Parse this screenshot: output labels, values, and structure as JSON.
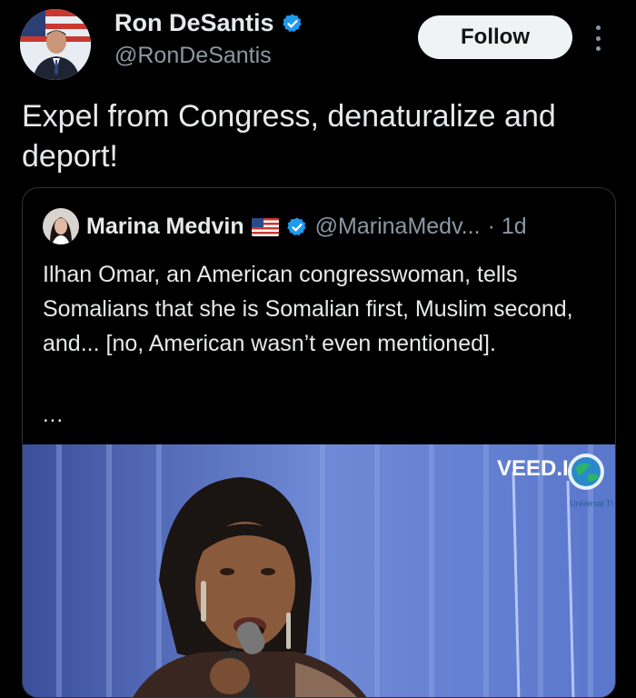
{
  "tweet": {
    "author_name": "Ron DeSantis",
    "author_handle": "@RonDeSantis",
    "follow_label": "Follow",
    "text": "Expel from Congress, denaturalize and deport!"
  },
  "quoted_tweet": {
    "author_name": "Marina Medvin",
    "author_handle": "@MarinaMedv...",
    "time": "· 1d",
    "text": "Ilhan Omar, an American congresswoman, tells Somalians that she is Somalian first, Muslim second, and... [no, American wasn’t even mentioned].",
    "truncation": "...",
    "media_watermark": "VEED.IO",
    "media_watermark_sub": "Universal TV"
  },
  "icons": {
    "verified": "verified-badge-icon",
    "more": "more-options-icon",
    "flag": "us-flag-icon"
  },
  "colors": {
    "background": "#000000",
    "text": "#e7e9ea",
    "secondary_text": "#8b98a5",
    "verified_blue": "#1d9bf0",
    "follow_bg": "#eff3f4",
    "border": "#2f3336"
  }
}
